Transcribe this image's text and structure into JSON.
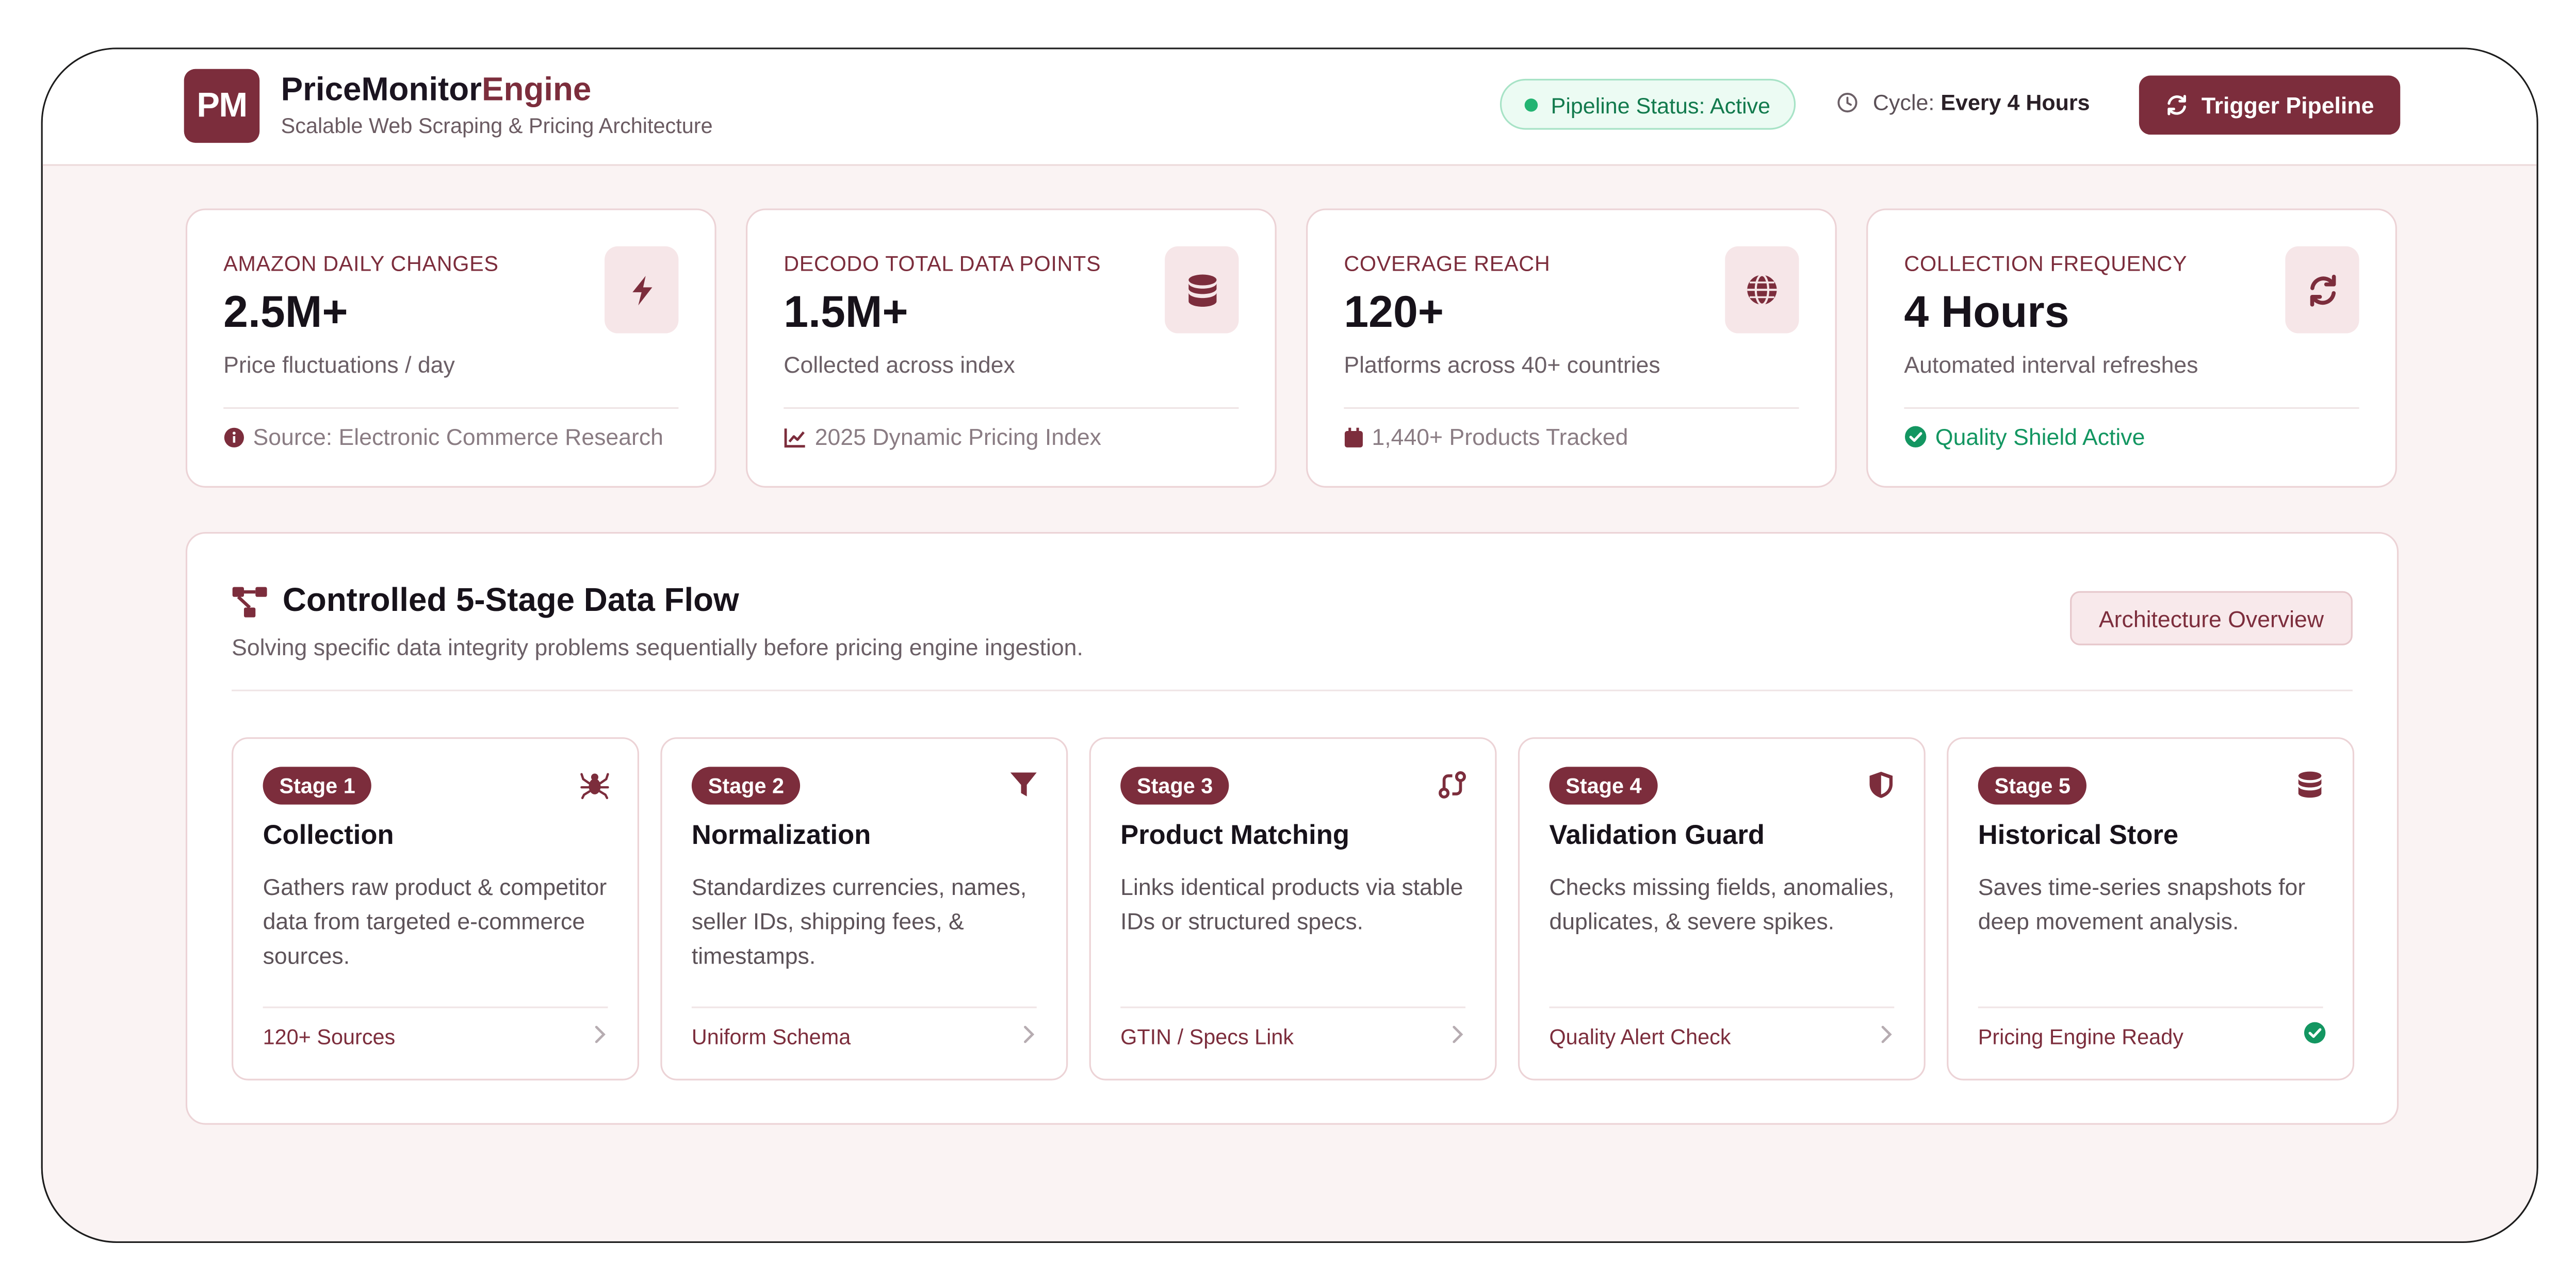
{
  "header": {
    "logo_text": "PM",
    "brand_primary": "PriceMonitor",
    "brand_accent": "Engine",
    "tagline": "Scalable Web Scraping & Pricing Architecture",
    "status_label": "Pipeline Status: Active",
    "cycle_label": "Cycle:",
    "cycle_value": "Every 4 Hours",
    "trigger_label": "Trigger Pipeline"
  },
  "stats": [
    {
      "label": "AMAZON DAILY CHANGES",
      "value": "2.5M+",
      "sub": "Price fluctuations / day",
      "foot": "Source: Electronic Commerce Research",
      "icon": "bolt-icon",
      "foot_icon": "info-icon"
    },
    {
      "label": "DECODO TOTAL DATA POINTS",
      "value": "1.5M+",
      "sub": "Collected across index",
      "foot": "2025 Dynamic Pricing Index",
      "icon": "database-icon",
      "foot_icon": "chart-line-icon"
    },
    {
      "label": "COVERAGE REACH",
      "value": "120+",
      "sub": "Platforms across 40+ countries",
      "foot": "1,440+ Products Tracked",
      "icon": "globe-icon",
      "foot_icon": "calendar-icon"
    },
    {
      "label": "COLLECTION FREQUENCY",
      "value": "4 Hours",
      "sub": "Automated interval refreshes",
      "foot": "Quality Shield Active",
      "icon": "refresh-icon",
      "foot_icon": "check-circle-icon"
    }
  ],
  "flow": {
    "title": "Controlled 5-Stage Data Flow",
    "subtitle": "Solving specific data integrity problems sequentially before pricing engine ingestion.",
    "arch_button": "Architecture Overview",
    "stages": [
      {
        "badge": "Stage 1",
        "title": "Collection",
        "desc": "Gathers raw product & competitor data from targeted e-commerce sources.",
        "tag": "120+ Sources",
        "icon": "spider-icon"
      },
      {
        "badge": "Stage 2",
        "title": "Normalization",
        "desc": "Standardizes currencies, names, seller IDs, shipping fees, & timestamps.",
        "tag": "Uniform Schema",
        "icon": "filter-icon"
      },
      {
        "badge": "Stage 3",
        "title": "Product Matching",
        "desc": "Links identical products via stable IDs or structured specs.",
        "tag": "GTIN / Specs Link",
        "icon": "route-icon"
      },
      {
        "badge": "Stage 4",
        "title": "Validation Guard",
        "desc": "Checks missing fields, anomalies, duplicates, & severe spikes.",
        "tag": "Quality Alert Check",
        "icon": "shield-icon"
      },
      {
        "badge": "Stage 5",
        "title": "Historical Store",
        "desc": "Saves time-series snapshots for deep movement analysis.",
        "tag": "Pricing Engine Ready",
        "icon": "database-icon"
      }
    ]
  },
  "colors": {
    "accent": "#7c2d3c",
    "success": "#139661",
    "background": "#faf3f3"
  }
}
